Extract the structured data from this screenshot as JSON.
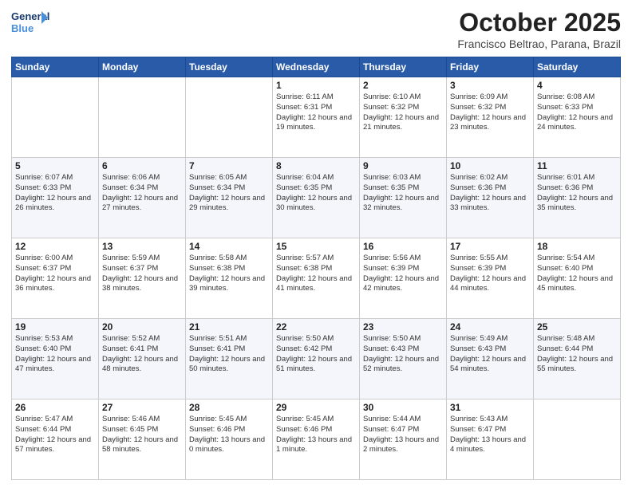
{
  "header": {
    "logo_line1": "General",
    "logo_line2": "Blue",
    "month": "October 2025",
    "location": "Francisco Beltrao, Parana, Brazil"
  },
  "weekdays": [
    "Sunday",
    "Monday",
    "Tuesday",
    "Wednesday",
    "Thursday",
    "Friday",
    "Saturday"
  ],
  "weeks": [
    [
      {
        "day": "",
        "content": ""
      },
      {
        "day": "",
        "content": ""
      },
      {
        "day": "",
        "content": ""
      },
      {
        "day": "1",
        "content": "Sunrise: 6:11 AM\nSunset: 6:31 PM\nDaylight: 12 hours\nand 19 minutes."
      },
      {
        "day": "2",
        "content": "Sunrise: 6:10 AM\nSunset: 6:32 PM\nDaylight: 12 hours\nand 21 minutes."
      },
      {
        "day": "3",
        "content": "Sunrise: 6:09 AM\nSunset: 6:32 PM\nDaylight: 12 hours\nand 23 minutes."
      },
      {
        "day": "4",
        "content": "Sunrise: 6:08 AM\nSunset: 6:33 PM\nDaylight: 12 hours\nand 24 minutes."
      }
    ],
    [
      {
        "day": "5",
        "content": "Sunrise: 6:07 AM\nSunset: 6:33 PM\nDaylight: 12 hours\nand 26 minutes."
      },
      {
        "day": "6",
        "content": "Sunrise: 6:06 AM\nSunset: 6:34 PM\nDaylight: 12 hours\nand 27 minutes."
      },
      {
        "day": "7",
        "content": "Sunrise: 6:05 AM\nSunset: 6:34 PM\nDaylight: 12 hours\nand 29 minutes."
      },
      {
        "day": "8",
        "content": "Sunrise: 6:04 AM\nSunset: 6:35 PM\nDaylight: 12 hours\nand 30 minutes."
      },
      {
        "day": "9",
        "content": "Sunrise: 6:03 AM\nSunset: 6:35 PM\nDaylight: 12 hours\nand 32 minutes."
      },
      {
        "day": "10",
        "content": "Sunrise: 6:02 AM\nSunset: 6:36 PM\nDaylight: 12 hours\nand 33 minutes."
      },
      {
        "day": "11",
        "content": "Sunrise: 6:01 AM\nSunset: 6:36 PM\nDaylight: 12 hours\nand 35 minutes."
      }
    ],
    [
      {
        "day": "12",
        "content": "Sunrise: 6:00 AM\nSunset: 6:37 PM\nDaylight: 12 hours\nand 36 minutes."
      },
      {
        "day": "13",
        "content": "Sunrise: 5:59 AM\nSunset: 6:37 PM\nDaylight: 12 hours\nand 38 minutes."
      },
      {
        "day": "14",
        "content": "Sunrise: 5:58 AM\nSunset: 6:38 PM\nDaylight: 12 hours\nand 39 minutes."
      },
      {
        "day": "15",
        "content": "Sunrise: 5:57 AM\nSunset: 6:38 PM\nDaylight: 12 hours\nand 41 minutes."
      },
      {
        "day": "16",
        "content": "Sunrise: 5:56 AM\nSunset: 6:39 PM\nDaylight: 12 hours\nand 42 minutes."
      },
      {
        "day": "17",
        "content": "Sunrise: 5:55 AM\nSunset: 6:39 PM\nDaylight: 12 hours\nand 44 minutes."
      },
      {
        "day": "18",
        "content": "Sunrise: 5:54 AM\nSunset: 6:40 PM\nDaylight: 12 hours\nand 45 minutes."
      }
    ],
    [
      {
        "day": "19",
        "content": "Sunrise: 5:53 AM\nSunset: 6:40 PM\nDaylight: 12 hours\nand 47 minutes."
      },
      {
        "day": "20",
        "content": "Sunrise: 5:52 AM\nSunset: 6:41 PM\nDaylight: 12 hours\nand 48 minutes."
      },
      {
        "day": "21",
        "content": "Sunrise: 5:51 AM\nSunset: 6:41 PM\nDaylight: 12 hours\nand 50 minutes."
      },
      {
        "day": "22",
        "content": "Sunrise: 5:50 AM\nSunset: 6:42 PM\nDaylight: 12 hours\nand 51 minutes."
      },
      {
        "day": "23",
        "content": "Sunrise: 5:50 AM\nSunset: 6:43 PM\nDaylight: 12 hours\nand 52 minutes."
      },
      {
        "day": "24",
        "content": "Sunrise: 5:49 AM\nSunset: 6:43 PM\nDaylight: 12 hours\nand 54 minutes."
      },
      {
        "day": "25",
        "content": "Sunrise: 5:48 AM\nSunset: 6:44 PM\nDaylight: 12 hours\nand 55 minutes."
      }
    ],
    [
      {
        "day": "26",
        "content": "Sunrise: 5:47 AM\nSunset: 6:44 PM\nDaylight: 12 hours\nand 57 minutes."
      },
      {
        "day": "27",
        "content": "Sunrise: 5:46 AM\nSunset: 6:45 PM\nDaylight: 12 hours\nand 58 minutes."
      },
      {
        "day": "28",
        "content": "Sunrise: 5:45 AM\nSunset: 6:46 PM\nDaylight: 13 hours\nand 0 minutes."
      },
      {
        "day": "29",
        "content": "Sunrise: 5:45 AM\nSunset: 6:46 PM\nDaylight: 13 hours\nand 1 minute."
      },
      {
        "day": "30",
        "content": "Sunrise: 5:44 AM\nSunset: 6:47 PM\nDaylight: 13 hours\nand 2 minutes."
      },
      {
        "day": "31",
        "content": "Sunrise: 5:43 AM\nSunset: 6:47 PM\nDaylight: 13 hours\nand 4 minutes."
      },
      {
        "day": "",
        "content": ""
      }
    ]
  ]
}
